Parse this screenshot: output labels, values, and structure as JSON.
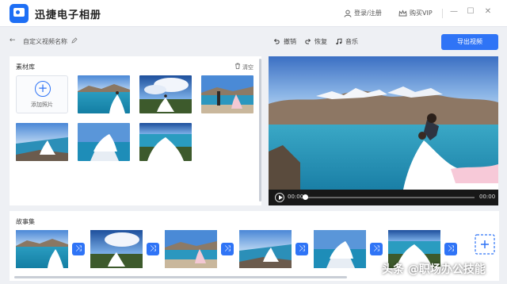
{
  "app": {
    "title": "迅捷电子相册"
  },
  "titlebar": {
    "login_label": "登录/注册",
    "vip_label": "购买VIP",
    "minimize": "—",
    "maximize": "☐",
    "close": "✕"
  },
  "toolbar": {
    "back": "←",
    "project_name": "自定义视频名称",
    "undo": "撤销",
    "redo": "恢复",
    "music": "音乐",
    "export": "导出视频"
  },
  "library": {
    "title": "素材库",
    "clear": "清空",
    "add_label": "添加照片",
    "add_symbol": "+"
  },
  "preview": {
    "time_current": "00:00",
    "time_total": "00:00"
  },
  "story": {
    "title": "故事集",
    "transition_symbol": "⤨"
  },
  "watermark": {
    "text": "头条 @职场办公技能"
  },
  "colors": {
    "accent": "#2f74f6",
    "panel": "#ffffff",
    "background": "#eef0f4"
  }
}
